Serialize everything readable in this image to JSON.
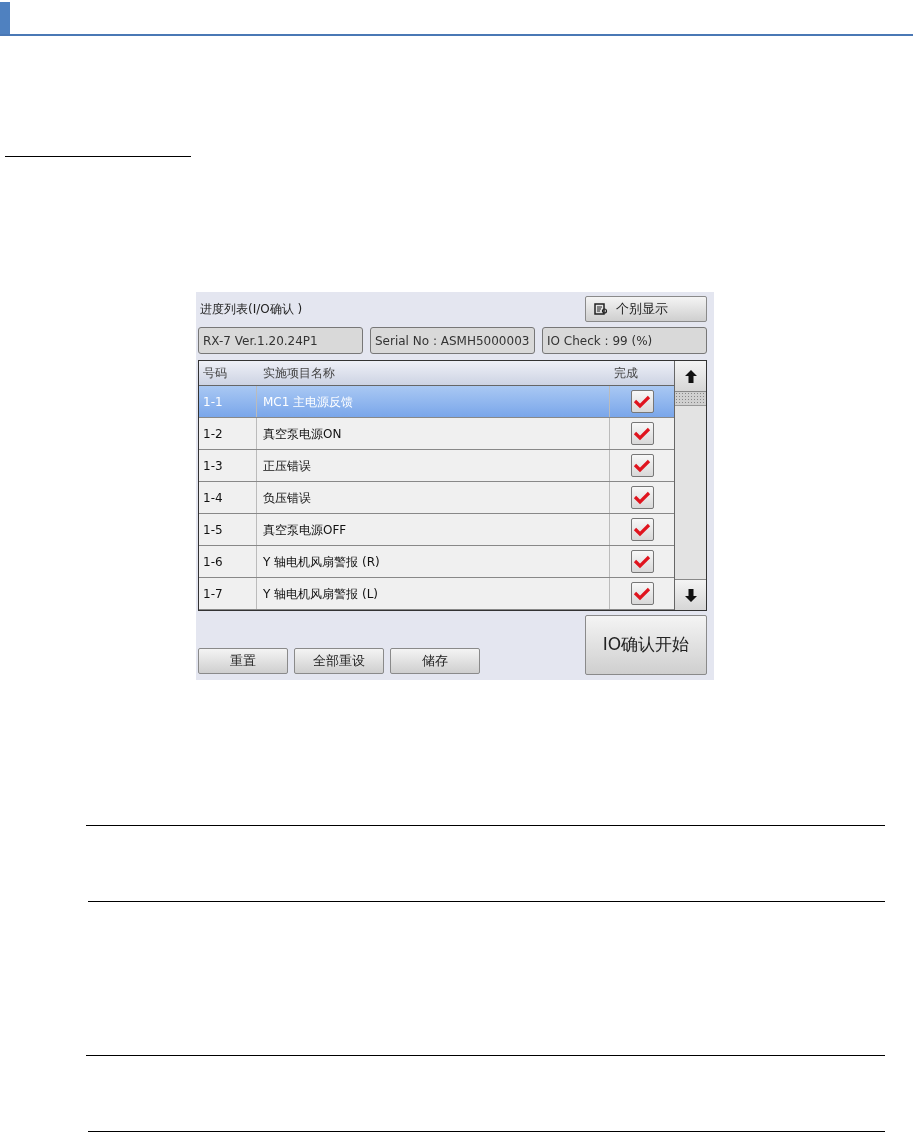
{
  "panel": {
    "title": "进度列表(I/O确认 )",
    "view_button": "个别显示",
    "info_fields": [
      "RX-7 Ver.1.20.24P1",
      "Serial No : ASMH5000003",
      "IO Check : 99 (%)"
    ],
    "table": {
      "columns": [
        "号码",
        "实施项目名称",
        "完成"
      ],
      "rows": [
        {
          "number": "1-1",
          "name": "MC1 主电源反馈",
          "checked": true,
          "selected": true
        },
        {
          "number": "1-2",
          "name": "真空泵电源ON",
          "checked": true,
          "selected": false
        },
        {
          "number": "1-3",
          "name": "正压错误",
          "checked": true,
          "selected": false
        },
        {
          "number": "1-4",
          "name": "负压错误",
          "checked": true,
          "selected": false
        },
        {
          "number": "1-5",
          "name": "真空泵电源OFF",
          "checked": true,
          "selected": false
        },
        {
          "number": "1-6",
          "name": "Y 轴电机风扇警报 (R)",
          "checked": true,
          "selected": false
        },
        {
          "number": "1-7",
          "name": "Y 轴电机风扇警报 (L)",
          "checked": true,
          "selected": false
        }
      ]
    },
    "buttons": [
      "重置",
      "全部重设",
      "储存"
    ],
    "start_button": "IO确认开始"
  }
}
